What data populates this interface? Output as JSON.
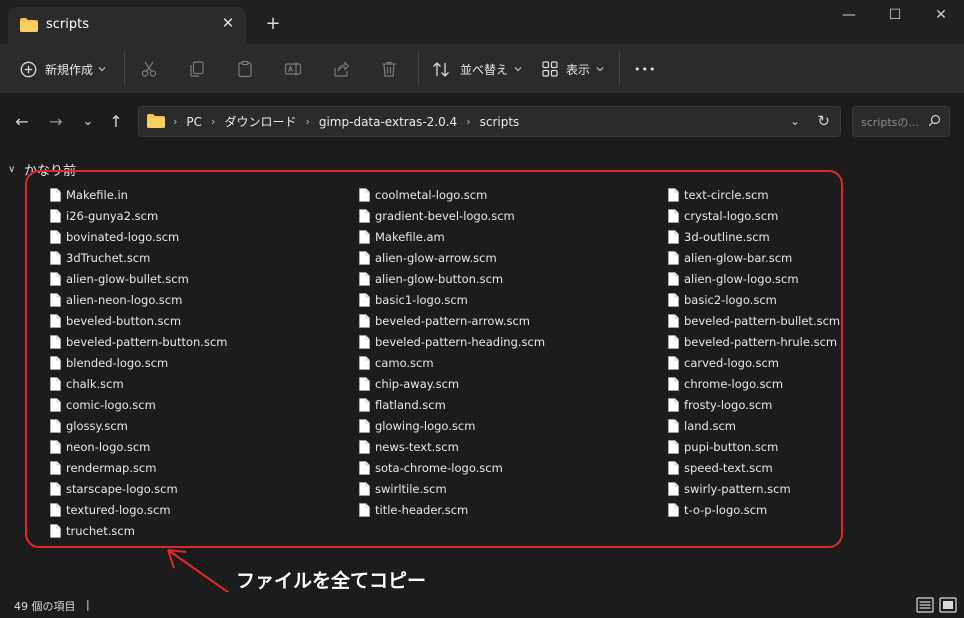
{
  "window": {
    "tab_title": "scripts",
    "tab_close": "✕",
    "new_tab": "+",
    "minimize": "—",
    "maximize": "☐",
    "close": "✕"
  },
  "toolbar": {
    "new_label": "新規作成",
    "sort_label": "並べ替え",
    "view_label": "表示",
    "more_label": "•••"
  },
  "nav": {
    "back": "←",
    "forward": "→",
    "recent": "⌄",
    "up": "↑"
  },
  "address": {
    "crumbs": [
      "PC",
      "ダウンロード",
      "gimp-data-extras-2.0.4",
      "scripts"
    ],
    "chevron": "›",
    "dropdown": "⌄",
    "refresh": "↻"
  },
  "search": {
    "placeholder": "scriptsの..."
  },
  "group": {
    "label": "かなり前",
    "chevron": "∨"
  },
  "files": {
    "col1": [
      "Makefile.in",
      "i26-gunya2.scm",
      "bovinated-logo.scm",
      "3dTruchet.scm",
      "alien-glow-bullet.scm",
      "alien-neon-logo.scm",
      "beveled-button.scm",
      "beveled-pattern-button.scm",
      "blended-logo.scm",
      "chalk.scm",
      "comic-logo.scm",
      "glossy.scm",
      "neon-logo.scm",
      "rendermap.scm",
      "starscape-logo.scm",
      "textured-logo.scm",
      "truchet.scm"
    ],
    "col2": [
      "coolmetal-logo.scm",
      "gradient-bevel-logo.scm",
      "Makefile.am",
      "alien-glow-arrow.scm",
      "alien-glow-button.scm",
      "basic1-logo.scm",
      "beveled-pattern-arrow.scm",
      "beveled-pattern-heading.scm",
      "camo.scm",
      "chip-away.scm",
      "flatland.scm",
      "glowing-logo.scm",
      "news-text.scm",
      "sota-chrome-logo.scm",
      "swirltile.scm",
      "title-header.scm"
    ],
    "col3": [
      "text-circle.scm",
      "crystal-logo.scm",
      "3d-outline.scm",
      "alien-glow-bar.scm",
      "alien-glow-logo.scm",
      "basic2-logo.scm",
      "beveled-pattern-bullet.scm",
      "beveled-pattern-hrule.scm",
      "carved-logo.scm",
      "chrome-logo.scm",
      "frosty-logo.scm",
      "land.scm",
      "pupi-button.scm",
      "speed-text.scm",
      "swirly-pattern.scm",
      "t-o-p-logo.scm"
    ]
  },
  "annotation": {
    "text": "ファイルを全てコピー",
    "color": "#e0282e"
  },
  "status": {
    "count": "49 個の項目",
    "caret": "|"
  },
  "colors": {
    "folder": "#f2c14e",
    "accent_red": "#e0282e"
  }
}
